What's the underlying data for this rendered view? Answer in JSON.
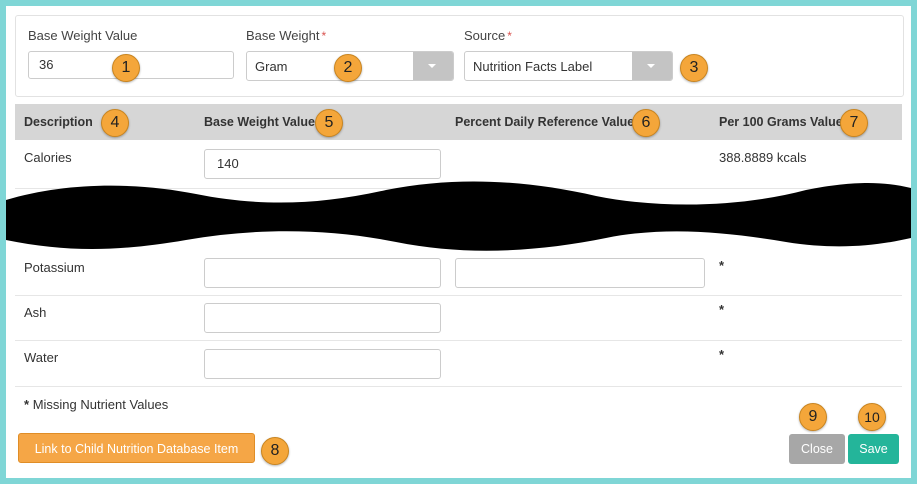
{
  "header": {
    "base_weight_value": {
      "label": "Base Weight Value",
      "value": "36"
    },
    "base_weight": {
      "label": "Base Weight",
      "required_mark": "*",
      "value": "Gram"
    },
    "source": {
      "label": "Source",
      "required_mark": "*",
      "value": "Nutrition Facts Label"
    }
  },
  "table": {
    "columns": [
      "Description",
      "Base Weight Value",
      "Percent Daily Reference Value",
      "Per 100 Grams Value"
    ],
    "rows": [
      {
        "description": "Calories",
        "base_weight_value": "140",
        "percent_daily": "",
        "per_100g": "388.8889 kcals"
      },
      {
        "description": "Potassium",
        "base_weight_value": "",
        "percent_daily": "",
        "per_100g": "*"
      },
      {
        "description": "Ash",
        "base_weight_value": "",
        "percent_daily": "",
        "per_100g": "*"
      },
      {
        "description": "Water",
        "base_weight_value": "",
        "percent_daily": "",
        "per_100g": "*"
      }
    ]
  },
  "footnote": {
    "mark": "*",
    "text": "Missing Nutrient Values"
  },
  "buttons": {
    "link": "Link to Child Nutrition Database Item",
    "close": "Close",
    "save": "Save"
  },
  "badges": [
    "1",
    "2",
    "3",
    "4",
    "5",
    "6",
    "7",
    "8",
    "9",
    "10"
  ],
  "icons": {
    "dropdown": "chevron-down-icon"
  },
  "colors": {
    "badge": "#f4a63a",
    "link_button": "#f5a646",
    "close_button": "#a7a7a7",
    "save_button": "#24b59a",
    "frame_border": "#7fd6d6",
    "required": "#d9534f"
  }
}
